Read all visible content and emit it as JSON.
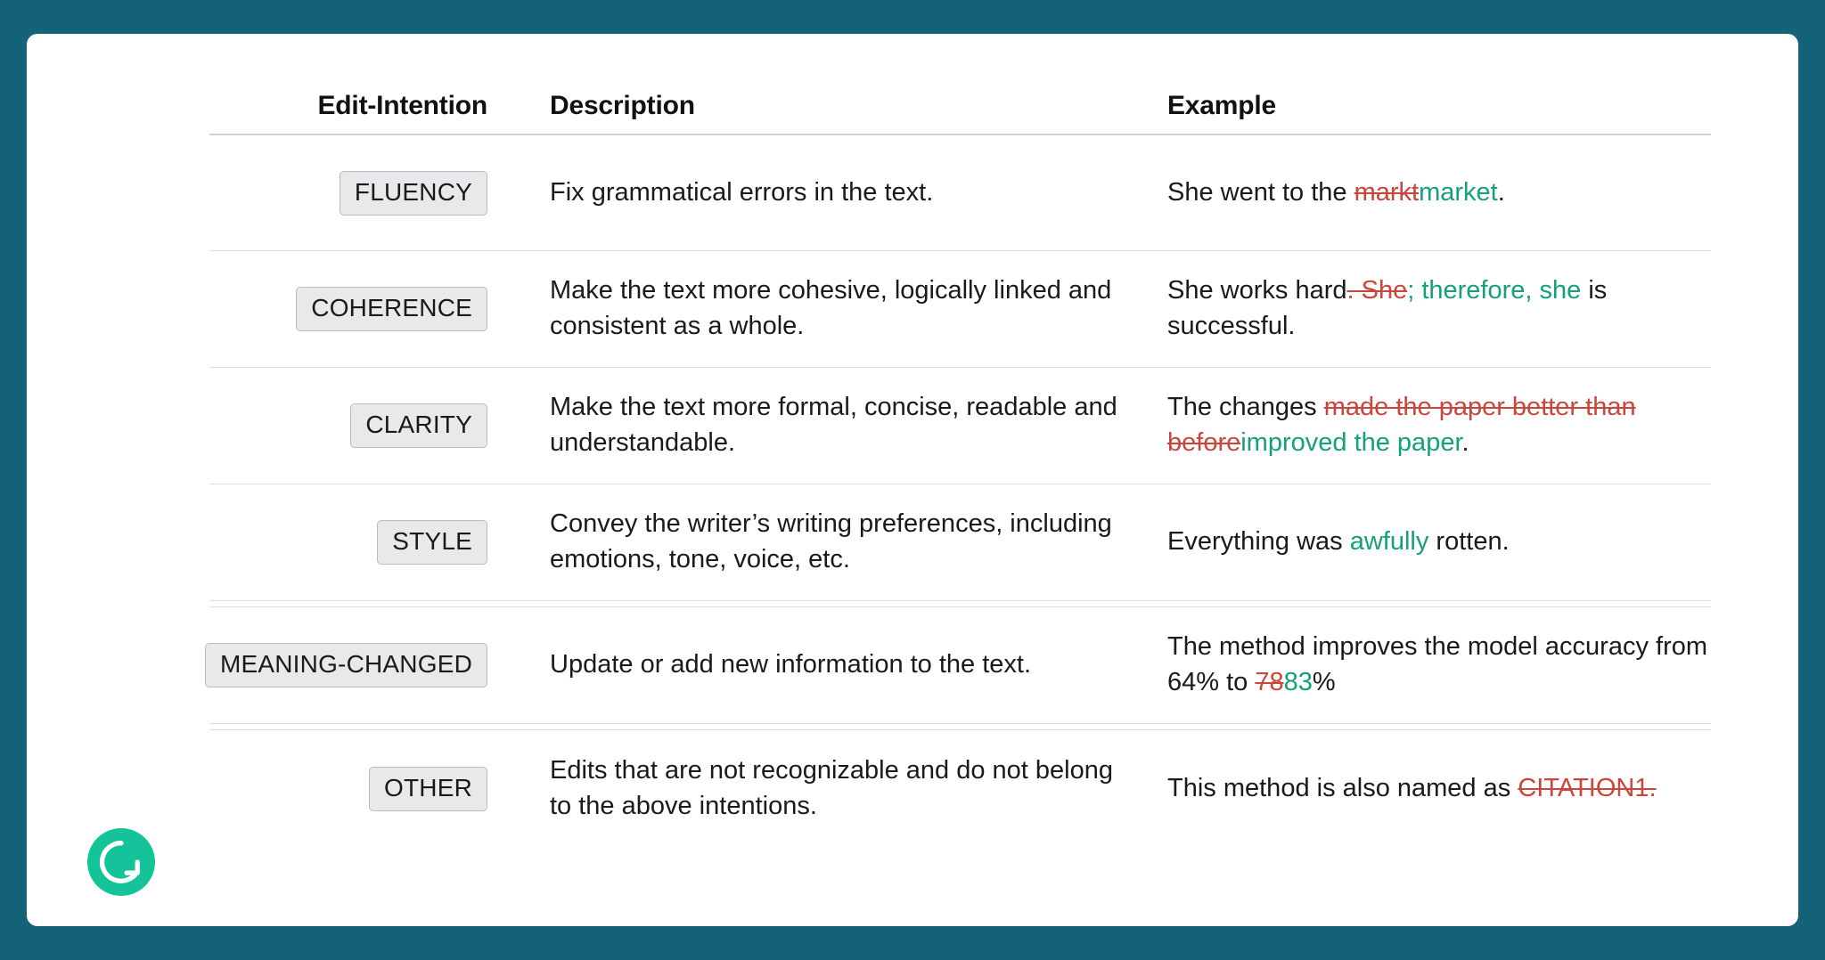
{
  "theme": {
    "border_color": "#146277",
    "card_color": "#ffffff",
    "chip_bg": "#e8e9ea",
    "chip_border": "#b9bcbe",
    "deletion_color": "#c9463c",
    "insertion_color": "#14a07a",
    "logo_color": "#15c39a"
  },
  "table": {
    "headers": {
      "intention": "Edit-Intention",
      "description": "Description",
      "example": "Example"
    },
    "rows": [
      {
        "tag": "FLUENCY",
        "description": "Fix grammatical errors in the text.",
        "example": {
          "parts": [
            {
              "type": "plain",
              "text": "She went to the "
            },
            {
              "type": "del",
              "text": "markt"
            },
            {
              "type": "ins",
              "text": "market"
            },
            {
              "type": "plain",
              "text": "."
            }
          ]
        }
      },
      {
        "tag": "COHERENCE",
        "description": "Make the text more cohesive, logically linked and consistent as a whole.",
        "example": {
          "parts": [
            {
              "type": "plain",
              "text": "She works hard"
            },
            {
              "type": "del",
              "text": ". She"
            },
            {
              "type": "ins",
              "text": "; therefore, she"
            },
            {
              "type": "plain",
              "text": " is successful."
            }
          ]
        }
      },
      {
        "tag": "CLARITY",
        "description": "Make the text more formal, concise, readable and understandable.",
        "example": {
          "parts": [
            {
              "type": "plain",
              "text": "The changes "
            },
            {
              "type": "del",
              "text": "made the paper better than before"
            },
            {
              "type": "ins",
              "text": "improved the paper"
            },
            {
              "type": "plain",
              "text": "."
            }
          ]
        }
      },
      {
        "tag": "STYLE",
        "description": "Convey the writer’s writing preferences, including emotions, tone, voice, etc.",
        "example": {
          "parts": [
            {
              "type": "plain",
              "text": "Everything was "
            },
            {
              "type": "ins",
              "text": "awfully"
            },
            {
              "type": "plain",
              "text": " rotten."
            }
          ]
        }
      },
      {
        "tag": "MEANING-CHANGED",
        "description": "Update or add new information to the text.",
        "example": {
          "parts": [
            {
              "type": "plain",
              "text": "The method improves the model accuracy from 64% to "
            },
            {
              "type": "del",
              "text": "78"
            },
            {
              "type": "ins",
              "text": "83"
            },
            {
              "type": "plain",
              "text": "%"
            }
          ]
        }
      },
      {
        "tag": "OTHER",
        "description": "Edits that are not recognizable and do not belong to the above intentions.",
        "example": {
          "parts": [
            {
              "type": "plain",
              "text": "This method is also named as "
            },
            {
              "type": "del",
              "text": "CITATION1."
            }
          ]
        }
      }
    ]
  },
  "logo": {
    "name": "grammarly-logo",
    "letter": "G"
  }
}
